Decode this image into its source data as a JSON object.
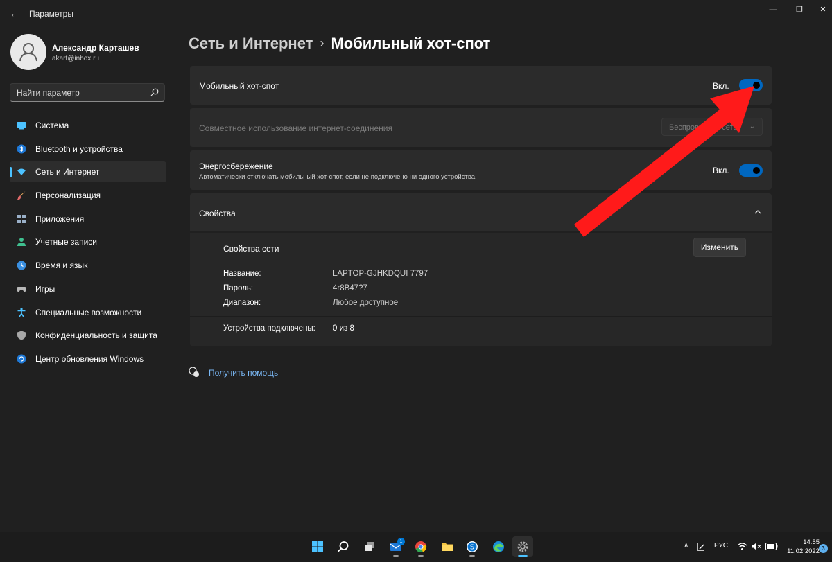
{
  "window": {
    "title": "Параметры"
  },
  "user": {
    "name": "Александр Карташев",
    "email": "akart@inbox.ru"
  },
  "search": {
    "placeholder": "Найти параметр"
  },
  "sidebar": {
    "items": [
      {
        "label": "Система",
        "icon": "monitor-icon",
        "active": false
      },
      {
        "label": "Bluetooth и устройства",
        "icon": "bluetooth-icon",
        "active": false
      },
      {
        "label": "Сеть и Интернет",
        "icon": "wifi-icon",
        "active": true
      },
      {
        "label": "Персонализация",
        "icon": "brush-icon",
        "active": false
      },
      {
        "label": "Приложения",
        "icon": "apps-icon",
        "active": false
      },
      {
        "label": "Учетные записи",
        "icon": "person-icon",
        "active": false
      },
      {
        "label": "Время и язык",
        "icon": "globe-clock-icon",
        "active": false
      },
      {
        "label": "Игры",
        "icon": "gamepad-icon",
        "active": false
      },
      {
        "label": "Специальные возможности",
        "icon": "accessibility-icon",
        "active": false
      },
      {
        "label": "Конфиденциальность и защита",
        "icon": "shield-icon",
        "active": false
      },
      {
        "label": "Центр обновления Windows",
        "icon": "update-icon",
        "active": false
      }
    ]
  },
  "breadcrumb": {
    "parent": "Сеть и Интернет",
    "separator": "›",
    "current": "Мобильный хот-спот"
  },
  "hotspot": {
    "title": "Мобильный хот-спот",
    "state": "Вкл.",
    "on": true
  },
  "sharing": {
    "title": "Совместное использование интернет-соединения",
    "dropdown": "Беспроводная сеть"
  },
  "power_saving": {
    "title": "Энергосбережение",
    "subtitle": "Автоматически отключать мобильный хот-спот, если не подключено ни одного устройства.",
    "state": "Вкл.",
    "on": true
  },
  "properties": {
    "header": "Свойства",
    "network_title": "Свойства сети",
    "edit_label": "Изменить",
    "rows": [
      {
        "key": "Название:",
        "value": "LAPTOP-GJHKDQUI 7797"
      },
      {
        "key": "Пароль:",
        "value": "4r8B47?7"
      },
      {
        "key": "Диапазон:",
        "value": "Любое доступное"
      }
    ],
    "devices_key": "Устройства подключены:",
    "devices_value": "0 из 8"
  },
  "help": {
    "label": "Получить помощь"
  },
  "taskbar": {
    "apps": [
      {
        "name": "start-icon",
        "active": false
      },
      {
        "name": "search-icon",
        "active": false
      },
      {
        "name": "task-view-icon",
        "active": false
      },
      {
        "name": "mail-icon",
        "active": false,
        "badge": "1"
      },
      {
        "name": "chrome-icon",
        "active": false
      },
      {
        "name": "explorer-icon",
        "active": false
      },
      {
        "name": "skype-icon",
        "active": false
      },
      {
        "name": "edge-icon",
        "active": false
      },
      {
        "name": "settings-icon",
        "active": true
      }
    ],
    "language": "РУС",
    "time": "14:55",
    "date": "11.02.2022",
    "notifications": "3"
  },
  "colors": {
    "accent": "#0067c0",
    "link": "#7ab8f5",
    "annotation_arrow": "#ff1a1a"
  }
}
